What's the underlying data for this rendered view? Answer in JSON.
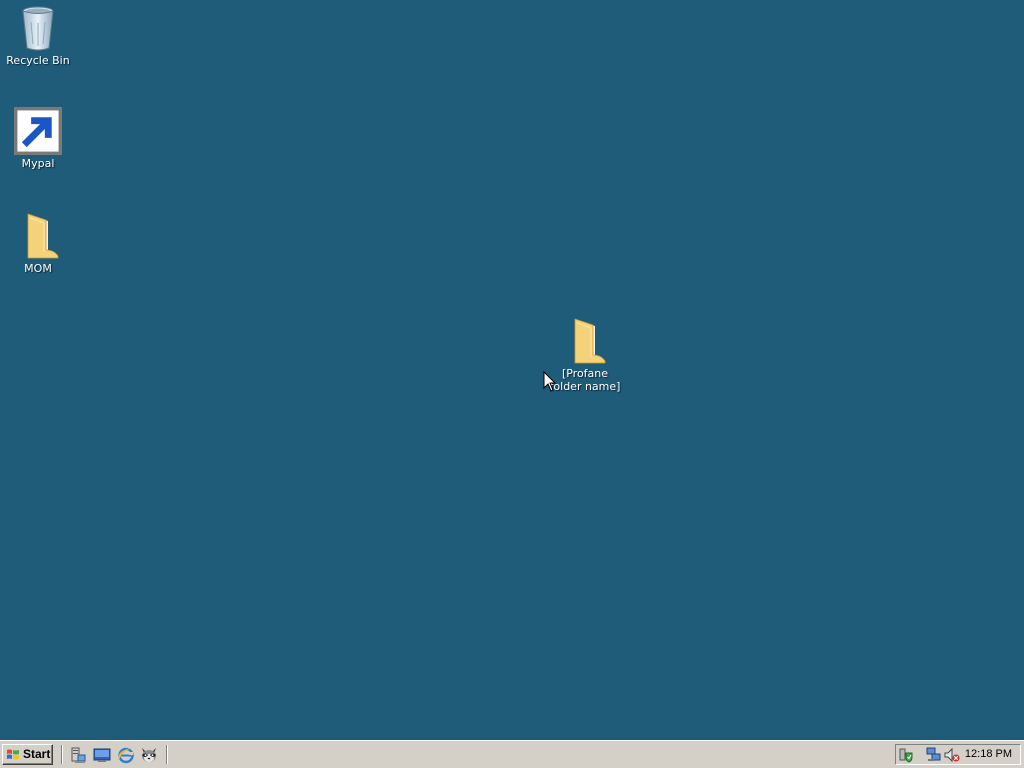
{
  "colors": {
    "desktop_background": "#1f5c79",
    "taskbar_background": "#d4d0c8",
    "icon_label_text": "#ffffff",
    "folder_yellow": "#f3d27a"
  },
  "desktop": {
    "icons": [
      {
        "name": "recycle-bin",
        "label": "Recycle Bin",
        "icon": "recycle-bin-icon"
      },
      {
        "name": "mypal",
        "label": "Mypal",
        "icon": "raccoon-icon",
        "shortcut": true
      },
      {
        "name": "mom-folder",
        "label": "MOM",
        "icon": "folder-icon"
      },
      {
        "name": "selected-folder",
        "label": "[Profane folder name]",
        "icon": "folder-icon"
      }
    ]
  },
  "taskbar": {
    "start_label": "Start",
    "quick_launch": [
      {
        "name": "server-manager",
        "icon": "server-manager-icon"
      },
      {
        "name": "show-desktop",
        "icon": "show-desktop-icon"
      },
      {
        "name": "internet-explorer",
        "icon": "internet-explorer-icon"
      },
      {
        "name": "mypal",
        "icon": "raccoon-icon"
      }
    ],
    "tray": {
      "icons": [
        "security-shield-icon",
        "network-disconnected-icon",
        "volume-muted-icon"
      ],
      "clock": "12:18 PM"
    }
  }
}
